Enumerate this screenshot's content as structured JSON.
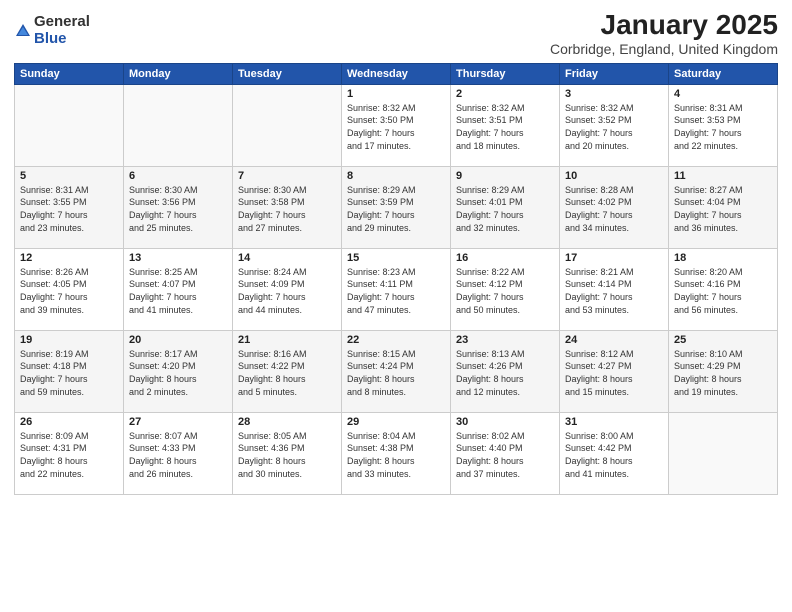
{
  "logo": {
    "general": "General",
    "blue": "Blue"
  },
  "title": "January 2025",
  "location": "Corbridge, England, United Kingdom",
  "headers": [
    "Sunday",
    "Monday",
    "Tuesday",
    "Wednesday",
    "Thursday",
    "Friday",
    "Saturday"
  ],
  "weeks": [
    [
      {
        "day": "",
        "info": ""
      },
      {
        "day": "",
        "info": ""
      },
      {
        "day": "",
        "info": ""
      },
      {
        "day": "1",
        "info": "Sunrise: 8:32 AM\nSunset: 3:50 PM\nDaylight: 7 hours\nand 17 minutes."
      },
      {
        "day": "2",
        "info": "Sunrise: 8:32 AM\nSunset: 3:51 PM\nDaylight: 7 hours\nand 18 minutes."
      },
      {
        "day": "3",
        "info": "Sunrise: 8:32 AM\nSunset: 3:52 PM\nDaylight: 7 hours\nand 20 minutes."
      },
      {
        "day": "4",
        "info": "Sunrise: 8:31 AM\nSunset: 3:53 PM\nDaylight: 7 hours\nand 22 minutes."
      }
    ],
    [
      {
        "day": "5",
        "info": "Sunrise: 8:31 AM\nSunset: 3:55 PM\nDaylight: 7 hours\nand 23 minutes."
      },
      {
        "day": "6",
        "info": "Sunrise: 8:30 AM\nSunset: 3:56 PM\nDaylight: 7 hours\nand 25 minutes."
      },
      {
        "day": "7",
        "info": "Sunrise: 8:30 AM\nSunset: 3:58 PM\nDaylight: 7 hours\nand 27 minutes."
      },
      {
        "day": "8",
        "info": "Sunrise: 8:29 AM\nSunset: 3:59 PM\nDaylight: 7 hours\nand 29 minutes."
      },
      {
        "day": "9",
        "info": "Sunrise: 8:29 AM\nSunset: 4:01 PM\nDaylight: 7 hours\nand 32 minutes."
      },
      {
        "day": "10",
        "info": "Sunrise: 8:28 AM\nSunset: 4:02 PM\nDaylight: 7 hours\nand 34 minutes."
      },
      {
        "day": "11",
        "info": "Sunrise: 8:27 AM\nSunset: 4:04 PM\nDaylight: 7 hours\nand 36 minutes."
      }
    ],
    [
      {
        "day": "12",
        "info": "Sunrise: 8:26 AM\nSunset: 4:05 PM\nDaylight: 7 hours\nand 39 minutes."
      },
      {
        "day": "13",
        "info": "Sunrise: 8:25 AM\nSunset: 4:07 PM\nDaylight: 7 hours\nand 41 minutes."
      },
      {
        "day": "14",
        "info": "Sunrise: 8:24 AM\nSunset: 4:09 PM\nDaylight: 7 hours\nand 44 minutes."
      },
      {
        "day": "15",
        "info": "Sunrise: 8:23 AM\nSunset: 4:11 PM\nDaylight: 7 hours\nand 47 minutes."
      },
      {
        "day": "16",
        "info": "Sunrise: 8:22 AM\nSunset: 4:12 PM\nDaylight: 7 hours\nand 50 minutes."
      },
      {
        "day": "17",
        "info": "Sunrise: 8:21 AM\nSunset: 4:14 PM\nDaylight: 7 hours\nand 53 minutes."
      },
      {
        "day": "18",
        "info": "Sunrise: 8:20 AM\nSunset: 4:16 PM\nDaylight: 7 hours\nand 56 minutes."
      }
    ],
    [
      {
        "day": "19",
        "info": "Sunrise: 8:19 AM\nSunset: 4:18 PM\nDaylight: 7 hours\nand 59 minutes."
      },
      {
        "day": "20",
        "info": "Sunrise: 8:17 AM\nSunset: 4:20 PM\nDaylight: 8 hours\nand 2 minutes."
      },
      {
        "day": "21",
        "info": "Sunrise: 8:16 AM\nSunset: 4:22 PM\nDaylight: 8 hours\nand 5 minutes."
      },
      {
        "day": "22",
        "info": "Sunrise: 8:15 AM\nSunset: 4:24 PM\nDaylight: 8 hours\nand 8 minutes."
      },
      {
        "day": "23",
        "info": "Sunrise: 8:13 AM\nSunset: 4:26 PM\nDaylight: 8 hours\nand 12 minutes."
      },
      {
        "day": "24",
        "info": "Sunrise: 8:12 AM\nSunset: 4:27 PM\nDaylight: 8 hours\nand 15 minutes."
      },
      {
        "day": "25",
        "info": "Sunrise: 8:10 AM\nSunset: 4:29 PM\nDaylight: 8 hours\nand 19 minutes."
      }
    ],
    [
      {
        "day": "26",
        "info": "Sunrise: 8:09 AM\nSunset: 4:31 PM\nDaylight: 8 hours\nand 22 minutes."
      },
      {
        "day": "27",
        "info": "Sunrise: 8:07 AM\nSunset: 4:33 PM\nDaylight: 8 hours\nand 26 minutes."
      },
      {
        "day": "28",
        "info": "Sunrise: 8:05 AM\nSunset: 4:36 PM\nDaylight: 8 hours\nand 30 minutes."
      },
      {
        "day": "29",
        "info": "Sunrise: 8:04 AM\nSunset: 4:38 PM\nDaylight: 8 hours\nand 33 minutes."
      },
      {
        "day": "30",
        "info": "Sunrise: 8:02 AM\nSunset: 4:40 PM\nDaylight: 8 hours\nand 37 minutes."
      },
      {
        "day": "31",
        "info": "Sunrise: 8:00 AM\nSunset: 4:42 PM\nDaylight: 8 hours\nand 41 minutes."
      },
      {
        "day": "",
        "info": ""
      }
    ]
  ]
}
